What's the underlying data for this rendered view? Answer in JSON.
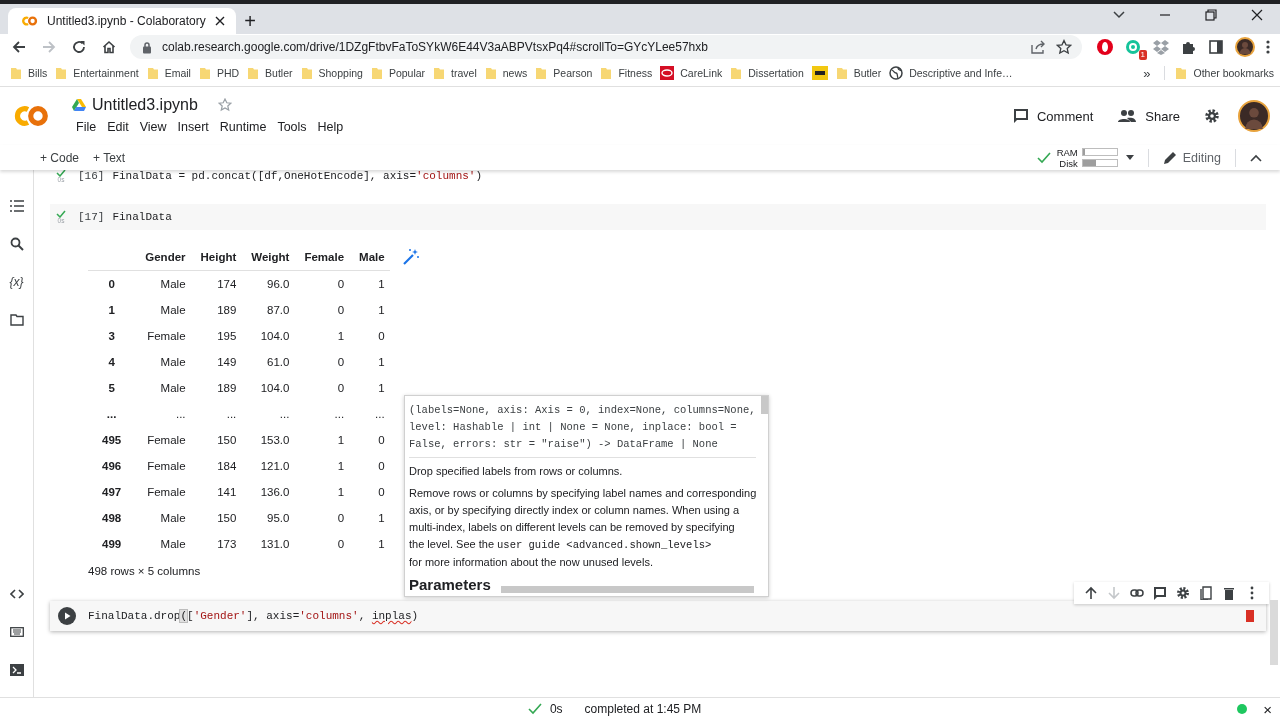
{
  "browser": {
    "tab": {
      "title": "Untitled3.ipynb - Colaboratory",
      "new_tab": "+"
    },
    "url": "colab.research.google.com/drive/1DZgFtbvFaToSYkW6E44V3aABPVtsxPq4#scrollTo=GYcYLee57hxb",
    "extension_badge": "1",
    "bookmarks": [
      {
        "label": "Bills",
        "kind": "folder"
      },
      {
        "label": "Entertainment",
        "kind": "folder"
      },
      {
        "label": "Email",
        "kind": "folder"
      },
      {
        "label": "PHD",
        "kind": "folder"
      },
      {
        "label": "Butler",
        "kind": "folder"
      },
      {
        "label": "Shopping",
        "kind": "folder"
      },
      {
        "label": "Popular",
        "kind": "folder"
      },
      {
        "label": "travel",
        "kind": "folder"
      },
      {
        "label": "news",
        "kind": "folder"
      },
      {
        "label": "Pearson",
        "kind": "folder"
      },
      {
        "label": "Fitness",
        "kind": "folder"
      },
      {
        "label": "CareLink",
        "kind": "redsite"
      },
      {
        "label": "Dissertation",
        "kind": "folder"
      },
      {
        "kind": "yellowsite"
      },
      {
        "label": "Butler",
        "kind": "folder"
      },
      {
        "label": "Descriptive and Infe…",
        "kind": "globe"
      }
    ],
    "overflow": "»",
    "other_bookmarks": "Other bookmarks"
  },
  "colab": {
    "title": "Untitled3.ipynb",
    "starred": false,
    "menu": [
      "File",
      "Edit",
      "View",
      "Insert",
      "Runtime",
      "Tools",
      "Help"
    ],
    "actions": [
      {
        "label": "Comment",
        "kind": "comment"
      },
      {
        "label": "Share",
        "kind": "share"
      }
    ],
    "add_buttons": [
      "+ Code",
      "+ Text"
    ],
    "runtime": {
      "connected": true,
      "ram_label": "RAM",
      "ram": {
        "level": 0.06
      },
      "disk_label": "Disk",
      "disk": {
        "level": 0.4
      }
    },
    "mode": "Editing"
  },
  "sidebar": {
    "top": [
      {
        "kind": "toc"
      },
      {
        "kind": "search"
      },
      {
        "kind": "variables",
        "glyph": "{x}"
      },
      {
        "kind": "files"
      }
    ],
    "bottom": [
      {
        "kind": "code"
      },
      {
        "kind": "palette"
      },
      {
        "kind": "terminal"
      }
    ]
  },
  "cells": [
    {
      "kind": "run",
      "count": "[16]",
      "time": "0s",
      "done": true,
      "code": [
        {
          "t": "FinalData = pd.concat([df,OneHotEncode], axis=",
          "kind": "plain"
        },
        {
          "t": "'columns'",
          "kind": "string"
        },
        {
          "t": ")",
          "kind": "plain"
        }
      ]
    },
    {
      "kind": "run",
      "count": "[17]",
      "time": "0s",
      "done": true,
      "code": [
        {
          "t": "FinalData",
          "kind": "plain"
        }
      ],
      "output": {
        "columns": [
          "",
          "Gender",
          "Height",
          "Weight",
          "Female",
          "Male"
        ],
        "rows": [
          [
            "0",
            "Male",
            "174",
            "96.0",
            "0",
            "1"
          ],
          [
            "1",
            "Male",
            "189",
            "87.0",
            "0",
            "1"
          ],
          [
            "3",
            "Female",
            "195",
            "104.0",
            "1",
            "0"
          ],
          [
            "4",
            "Male",
            "149",
            "61.0",
            "0",
            "1"
          ],
          [
            "5",
            "Male",
            "189",
            "104.0",
            "0",
            "1"
          ],
          [
            "...",
            "...",
            "...",
            "...",
            "...",
            "..."
          ],
          [
            "495",
            "Female",
            "150",
            "153.0",
            "1",
            "0"
          ],
          [
            "496",
            "Female",
            "184",
            "121.0",
            "1",
            "0"
          ],
          [
            "497",
            "Female",
            "141",
            "136.0",
            "1",
            "0"
          ],
          [
            "498",
            "Male",
            "150",
            "95.0",
            "0",
            "1"
          ],
          [
            "499",
            "Male",
            "173",
            "131.0",
            "0",
            "1"
          ]
        ],
        "footer": "498 rows × 5 columns"
      }
    },
    {
      "kind": "editing",
      "code": [
        {
          "t": "FinalData.drop",
          "kind": "plain"
        },
        {
          "t": "(",
          "kind": "bracket"
        },
        {
          "t": "[",
          "kind": "plain"
        },
        {
          "t": "'Gender'",
          "kind": "string"
        },
        {
          "t": "], axis=",
          "kind": "plain"
        },
        {
          "t": "'columns'",
          "kind": "string"
        },
        {
          "t": ", ",
          "kind": "plain"
        },
        {
          "t": "inplas",
          "kind": "error"
        },
        {
          "t": ")",
          "kind": "plain"
        }
      ]
    }
  ],
  "cell_toolbar": [
    {
      "kind": "up",
      "disabled": false
    },
    {
      "kind": "down",
      "disabled": true
    },
    {
      "kind": "link",
      "disabled": false
    },
    {
      "kind": "comment",
      "disabled": false
    },
    {
      "kind": "settings",
      "disabled": false
    },
    {
      "kind": "mirror",
      "disabled": false
    },
    {
      "kind": "delete",
      "disabled": false
    },
    {
      "kind": "more",
      "disabled": false
    }
  ],
  "tooltip": {
    "signature": [
      "(labels=None, axis: Axis = 0, index=None, columns=None,",
      "level: Hashable | int | None = None, inplace: bool =",
      "False, errors: str = \"raise\") -> DataFrame | None"
    ],
    "summary": "Drop specified labels from rows or columns.",
    "body": [
      [
        {
          "t": "Remove rows or columns by specifying label names and corresponding",
          "kind": "text"
        }
      ],
      [
        {
          "t": "axis, or by specifying directly index or column names. When using a",
          "kind": "text"
        }
      ],
      [
        {
          "t": "multi-index, labels on different levels can be removed by specifying",
          "kind": "text"
        }
      ],
      [
        {
          "t": "the level. See the ",
          "kind": "text"
        },
        {
          "t": "user guide <advanced.shown_levels>",
          "kind": "code"
        }
      ],
      [
        {
          "t": "for more information about the now unused levels.",
          "kind": "text"
        }
      ]
    ],
    "heading": "Parameters"
  },
  "status": {
    "time": "0s",
    "text": "completed at 1:45 PM",
    "connected": true,
    "close": "×"
  }
}
